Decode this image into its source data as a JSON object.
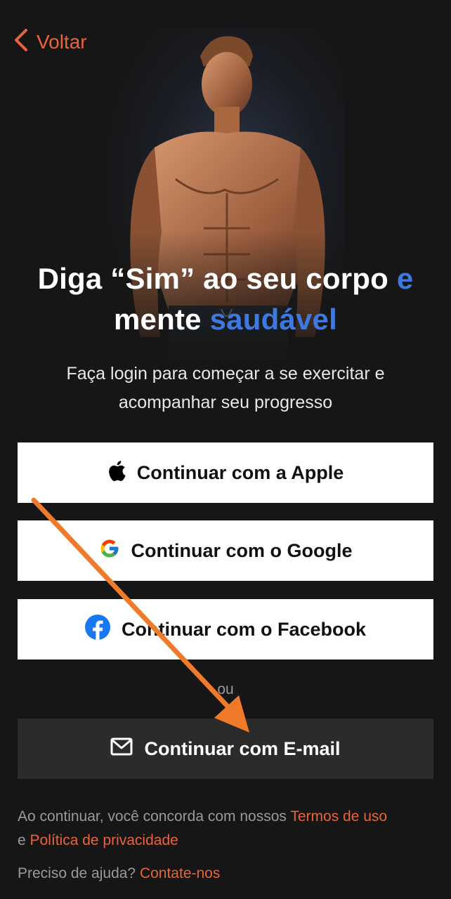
{
  "nav": {
    "back_label": "Voltar"
  },
  "headline": {
    "part1": "Diga “Sim” ao seu corpo ",
    "accent1": "e",
    "part2": "mente ",
    "accent2": "saudável"
  },
  "subtitle": {
    "line1": "Faça login para começar a se exercitar e",
    "line2": "acompanhar seu progresso"
  },
  "buttons": {
    "apple": "Continuar com a Apple",
    "google": "Continuar com o Google",
    "facebook": "Continuar com o Facebook",
    "email": "Continuar com E-mail"
  },
  "divider": "ou",
  "legal": {
    "prefix": "Ao continuar, você concorda com nossos ",
    "terms": "Termos de uso",
    "conjunction": "e ",
    "privacy": "Política de privacidade"
  },
  "help": {
    "prefix": "Preciso de ajuda? ",
    "contact": "Contate-nos"
  },
  "colors": {
    "background": "#161616",
    "accent_orange": "#e8643a",
    "accent_blue": "#3d79e0",
    "button_light": "#ffffff",
    "button_dark": "#2b2b2b",
    "annotation_arrow": "#f07a2a"
  },
  "icons": [
    "chevron-left-icon",
    "apple-icon",
    "google-icon",
    "facebook-icon",
    "mail-icon"
  ]
}
